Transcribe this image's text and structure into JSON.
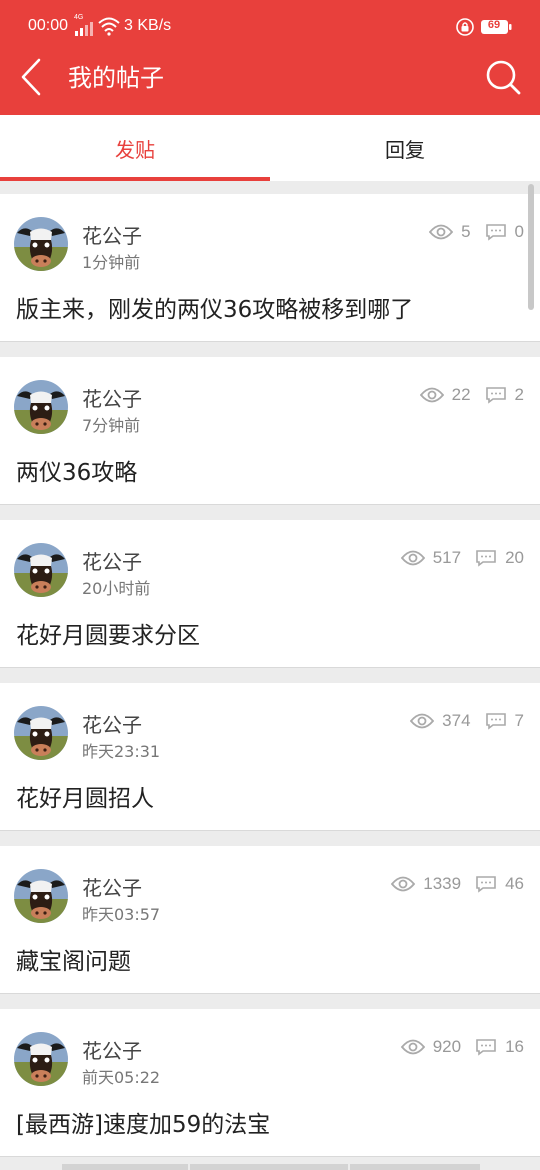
{
  "status_bar": {
    "time": "00:00",
    "network_label": "4G",
    "speed": "3 KB/s",
    "battery": "69",
    "icons": [
      "signal-icon",
      "wifi-icon",
      "lock-icon",
      "battery-icon"
    ]
  },
  "header": {
    "title": "我的帖子",
    "back_icon": "back-chevron-icon",
    "search_icon": "search-icon",
    "bg_color": "#e8403c"
  },
  "tabs": [
    {
      "label": "发贴",
      "active": true
    },
    {
      "label": "回复",
      "active": false
    }
  ],
  "posts": [
    {
      "author": "花公子",
      "time": "1分钟前",
      "views": "5",
      "replies": "0",
      "title": "版主来，刚发的两仪36攻略被移到哪了"
    },
    {
      "author": "花公子",
      "time": "7分钟前",
      "views": "22",
      "replies": "2",
      "title": "两仪36攻略"
    },
    {
      "author": "花公子",
      "time": "20小时前",
      "views": "517",
      "replies": "20",
      "title": "花好月圆要求分区"
    },
    {
      "author": "花公子",
      "time": "昨天23:31",
      "views": "374",
      "replies": "7",
      "title": "花好月圆招人"
    },
    {
      "author": "花公子",
      "time": "昨天03:57",
      "views": "1339",
      "replies": "46",
      "title": "藏宝阁问题"
    },
    {
      "author": "花公子",
      "time": "前天05:22",
      "views": "920",
      "replies": "16",
      "title": "[最西游]速度加59的法宝"
    }
  ],
  "colors": {
    "accent": "#e8403c",
    "muted": "#999999",
    "background": "#ececec"
  }
}
